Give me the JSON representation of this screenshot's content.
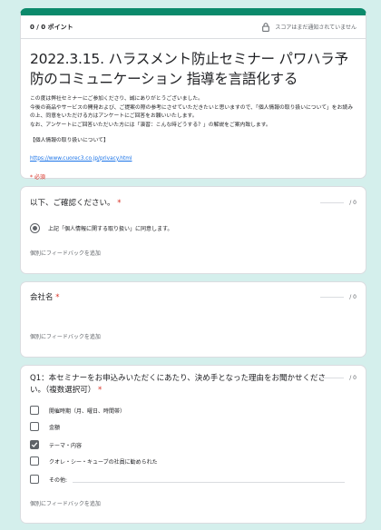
{
  "header": {
    "score": "0 / 0 ポイント",
    "score_notice": "スコアはまだ通知されていません",
    "title": "2022.3.15. ハラスメント防止セミナー パワハラ予防のコミュニケーション 指導を言語化する",
    "description": "この度は弊社セミナーにご参加くださり、誠にありがとうございました。\n今後の商品やサービスの開発および、ご提案の際の参考にさせていただきたいと思いますので、「個人情報の取り扱いについて」をお読みの上、同意をいただける方はアンケートにご回答をお願いいたします。\nなお、アンケートにご回答いただいた方には「演習：こんな時どうする？」の解説をご案内致します。",
    "privacy_heading": "【個人情報の取り扱いについて】",
    "privacy_link": "https://www.cuorec3.co.jp/privacy.html",
    "required_note": "* 必須"
  },
  "colors": {
    "accent": "#0b8a6b",
    "background": "#d4efec",
    "required": "#d93025",
    "link": "#1a73e8"
  },
  "questions": [
    {
      "title": "以下、ご確認ください。",
      "points": "0",
      "option": "上記「個人情報に関する取り扱い」に同意します。",
      "feedback": "個別にフィードバックを追加"
    },
    {
      "title": "会社名",
      "points": "0",
      "feedback": "個別にフィードバックを追加"
    },
    {
      "title": "Q1：本セミナーをお申込みいただくにあたり、決め手となった理由をお聞かせください。（複数選択可）",
      "points": "0",
      "options": [
        {
          "label": "開催時期（月、曜日、時間帯）",
          "checked": false
        },
        {
          "label": "金額",
          "checked": false
        },
        {
          "label": "テーマ・内容",
          "checked": true
        },
        {
          "label": "クオレ・シー・キューブの社員に勧められた",
          "checked": false
        },
        {
          "label": "その他:",
          "checked": false
        }
      ],
      "feedback": "個別にフィードバックを追加"
    }
  ]
}
